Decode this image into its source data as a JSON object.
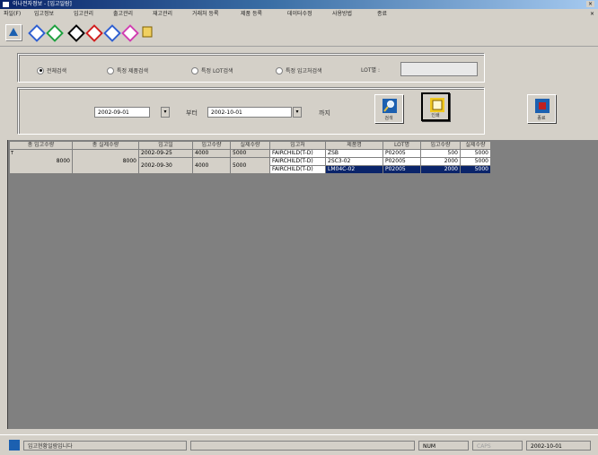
{
  "window": {
    "title": "이나전자정보 - [입고일람]"
  },
  "menu": [
    "파일(F)",
    "입고정보",
    "입고관리",
    "출고관리",
    "재고관리",
    "거래처 등록",
    "제품 등록",
    "데이터수정",
    "사용방법",
    "종료"
  ],
  "toolbar": {
    "icons": [
      "app-icon",
      "blue-diamond-icon",
      "green-diamond-icon",
      "black-diamond-icon",
      "red-diamond-icon",
      "blue-diamond-icon",
      "pink-diamond-icon",
      "folder-icon"
    ]
  },
  "filter": {
    "radios": [
      {
        "label": "전체검색",
        "checked": true
      },
      {
        "label": "특정 제품검색",
        "checked": false
      },
      {
        "label": "특정 LOT검색",
        "checked": false
      },
      {
        "label": "특정 입고처검색",
        "checked": false
      }
    ],
    "lot_label": "LOT별 :",
    "lot_value": ""
  },
  "period": {
    "from_date": "2002-09-01",
    "from_suffix": "부터",
    "to_date": "2002-10-01",
    "to_suffix": "까지",
    "search_label": "검색",
    "print_label": "인쇄",
    "exit_label": "종료"
  },
  "grid": {
    "headers": [
      "총 입고수량",
      "총 실제수량",
      "입고일",
      "입고수량",
      "실제수량",
      "입고처",
      "제품명",
      "LOT명",
      "입고수량",
      "실제수량"
    ],
    "group": {
      "marker": "T",
      "total_in": "8000",
      "total_real": "8000",
      "sub": [
        {
          "date": "2002-09-25",
          "in": "4000",
          "real": "5000"
        },
        {
          "date": "2002-09-30",
          "in": "4000",
          "real": "5000"
        }
      ]
    },
    "rows": [
      {
        "supplier": "FAIRCHILD(T-D)",
        "product": "ZSB",
        "lot": "P02005",
        "in": "500",
        "real": "5000"
      },
      {
        "supplier": "FAIRCHILD(T-D)",
        "product": "2SC3-02",
        "lot": "P02005",
        "in": "2000",
        "real": "5000"
      },
      {
        "supplier": "FAIRCHILD(T-D)",
        "product": "LM04C-02",
        "lot": "P02005",
        "in": "2000",
        "real": "5000"
      }
    ]
  },
  "status": {
    "message": "입고현황일람입니다",
    "num": "NUM",
    "caps": "CAPS",
    "date": "2002-10-01"
  }
}
